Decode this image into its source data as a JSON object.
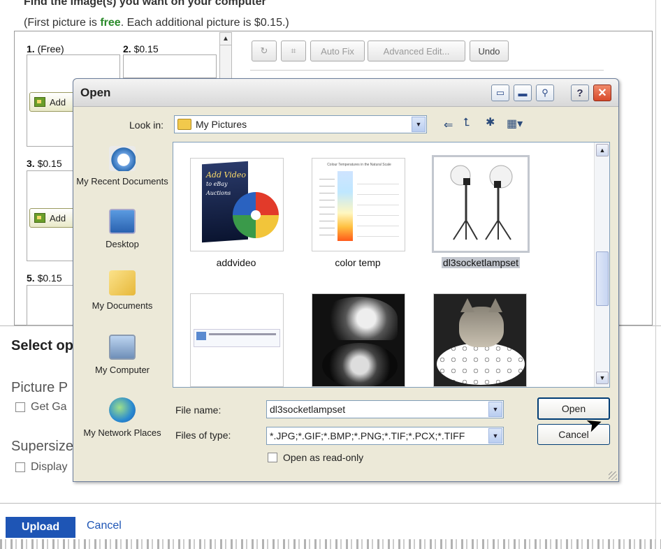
{
  "page": {
    "heading": "Find the image(s) you want on your computer",
    "note_pre": "(First picture is ",
    "note_free": "free",
    "note_post": ". Each additional picture is $0.15.)",
    "slots": [
      {
        "num": "1.",
        "price": " (Free)"
      },
      {
        "num": "2.",
        "price": " $0.15"
      },
      {
        "num": "3.",
        "price": " $0.15"
      },
      {
        "num": "5.",
        "price": " $0.15"
      }
    ],
    "add_label": "Add",
    "tools": {
      "auto_fix": "Auto Fix",
      "advanced_edit": "Advanced Edit...",
      "undo": "Undo"
    },
    "select_heading": "Select op",
    "picture_heading": "Picture P",
    "get_option": "Get Ga",
    "supersize_heading": "Supersize",
    "display_option": "Display",
    "upload_label": "Upload",
    "cancel_label": "Cancel"
  },
  "dialog": {
    "title": "Open",
    "look_in_label": "Look in:",
    "look_in_value": "My Pictures",
    "places": [
      {
        "label": "My Recent Documents",
        "icon": "recent-documents-icon"
      },
      {
        "label": "Desktop",
        "icon": "desktop-icon"
      },
      {
        "label": "My Documents",
        "icon": "my-documents-icon"
      },
      {
        "label": "My Computer",
        "icon": "my-computer-icon"
      },
      {
        "label": "My Network Places",
        "icon": "network-places-icon"
      }
    ],
    "files": [
      {
        "name": "addvideo",
        "selected": false
      },
      {
        "name": "color temp",
        "selected": false
      },
      {
        "name": "dl3socketlampset",
        "selected": true
      },
      {
        "name": "",
        "selected": false
      },
      {
        "name": "",
        "selected": false
      },
      {
        "name": "",
        "selected": false
      }
    ],
    "thumb_text": {
      "addvideo_line1": "Add Video",
      "addvideo_line2": "to eBay Auctions",
      "color_temp_title": "Colour Temperatures in the Natural Scale"
    },
    "file_name_label": "File name:",
    "file_name_value": "dl3socketlampset",
    "file_type_label": "Files of type:",
    "file_type_value": "*.JPG;*.GIF;*.BMP;*.PNG;*.TIF;*.PCX;*.TIFF",
    "readonly_label": "Open as read-only",
    "open_button": "Open",
    "cancel_button": "Cancel",
    "help_glyph": "?",
    "close_glyph": "✕"
  },
  "colors": {
    "accent": "#1e55b5",
    "free": "#2a8a2a",
    "dialog_bg": "#ece9d8"
  }
}
